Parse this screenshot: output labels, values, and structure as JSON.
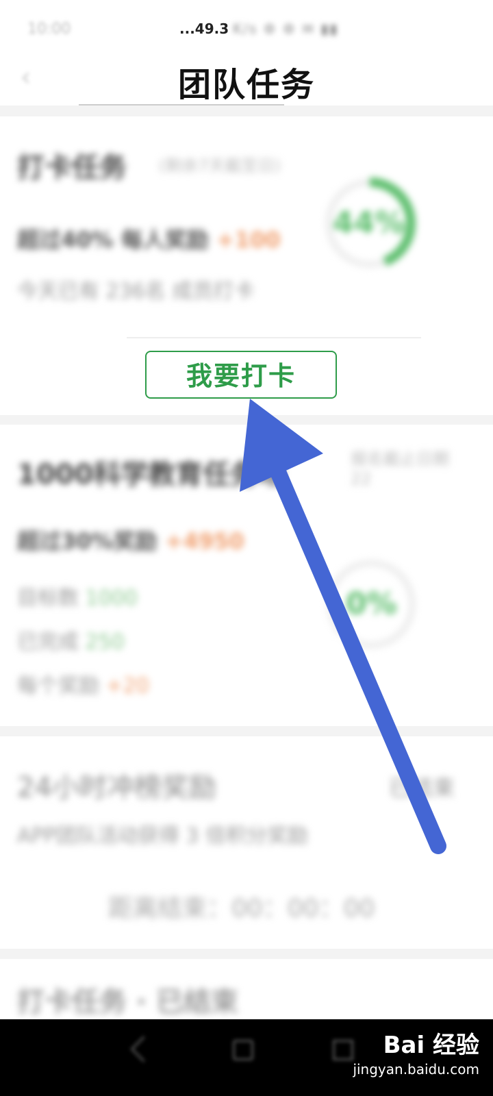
{
  "status_bar": {
    "time": "10:00",
    "network": "...49.3",
    "network_blurred": "K/s ⚙ ⚙ ✉ ▮▮"
  },
  "header": {
    "title": "团队任务",
    "back_icon": "chevron-left-icon"
  },
  "card1": {
    "title": "打卡任务",
    "subtitle": "(剩余7天截至日)",
    "reward_line": "超过40% 每人奖励",
    "reward_value": "+100",
    "status_line": "今天已有 236名 成员打卡",
    "progress": "44%",
    "progress_fraction": 0.44,
    "button_label": "我要打卡"
  },
  "card2": {
    "title": "1000科学教育任务场",
    "side_note": "报名截止日期 22",
    "reward_line": "超过30%奖励",
    "reward_value": "+4950",
    "rows": [
      {
        "label": "目标数",
        "value": "1000"
      },
      {
        "label": "已完成",
        "value": "250"
      },
      {
        "label": "每个奖励",
        "value": "+20"
      }
    ],
    "progress": "0%"
  },
  "card3": {
    "title": "24小时冲榜奖励",
    "status": "已结束",
    "description": "APP团队活动获得 3 倍积分奖励",
    "countdown": "距离结束：00：00：00"
  },
  "card4": {
    "title": "打卡任务 · 已结束"
  },
  "watermark": {
    "logo": "Bai  经验",
    "url": "jingyan.baidu.com"
  },
  "colors": {
    "accent_green": "#2e9c49",
    "arrow_blue": "#4466d4",
    "orange": "#f0a070"
  }
}
